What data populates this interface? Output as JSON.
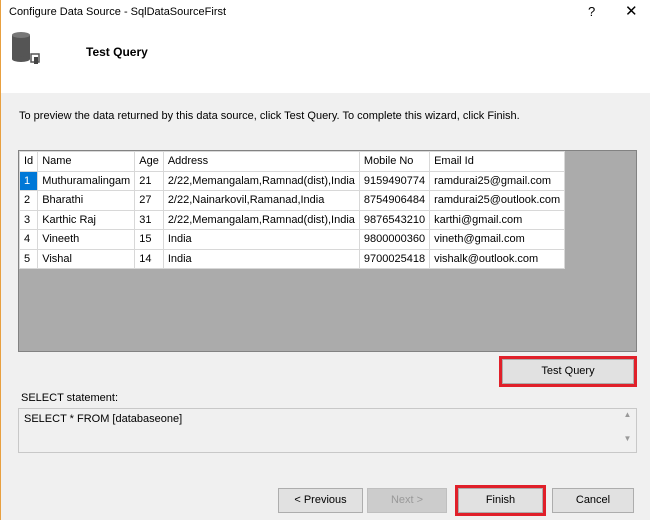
{
  "window": {
    "title": "Configure Data Source - SqlDataSourceFirst",
    "help": "?",
    "close": "✕"
  },
  "header": {
    "title": "Test Query",
    "icon": "database-connect-icon"
  },
  "instructions": "To preview the data returned by this data source, click Test Query. To complete this wizard, click Finish.",
  "grid": {
    "columns": [
      "Id",
      "Name",
      "Age",
      "Address",
      "Mobile No",
      "Email Id"
    ],
    "rows": [
      [
        "1",
        "Muthuramalingam",
        "21",
        "2/22,Memangalam,Ramnad(dist),India",
        "9159490774",
        "ramdurai25@gmail.com"
      ],
      [
        "2",
        "Bharathi",
        "27",
        "2/22,Nainarkovil,Ramanad,India",
        "8754906484",
        "ramdurai25@outlook.com"
      ],
      [
        "3",
        "Karthic Raj",
        "31",
        "2/22,Memangalam,Ramnad(dist),India",
        "9876543210",
        "karthi@gmail.com"
      ],
      [
        "4",
        "Vineeth",
        "15",
        "India",
        "9800000360",
        "vineth@gmail.com"
      ],
      [
        "5",
        "Vishal",
        "14",
        "India",
        "9700025418",
        "vishalk@outlook.com"
      ]
    ]
  },
  "test_query_label": "Test Query",
  "select_label": "SELECT statement:",
  "select_value": "SELECT * FROM [databaseone]",
  "buttons": {
    "previous": "< Previous",
    "next": "Next >",
    "finish": "Finish",
    "cancel": "Cancel"
  }
}
